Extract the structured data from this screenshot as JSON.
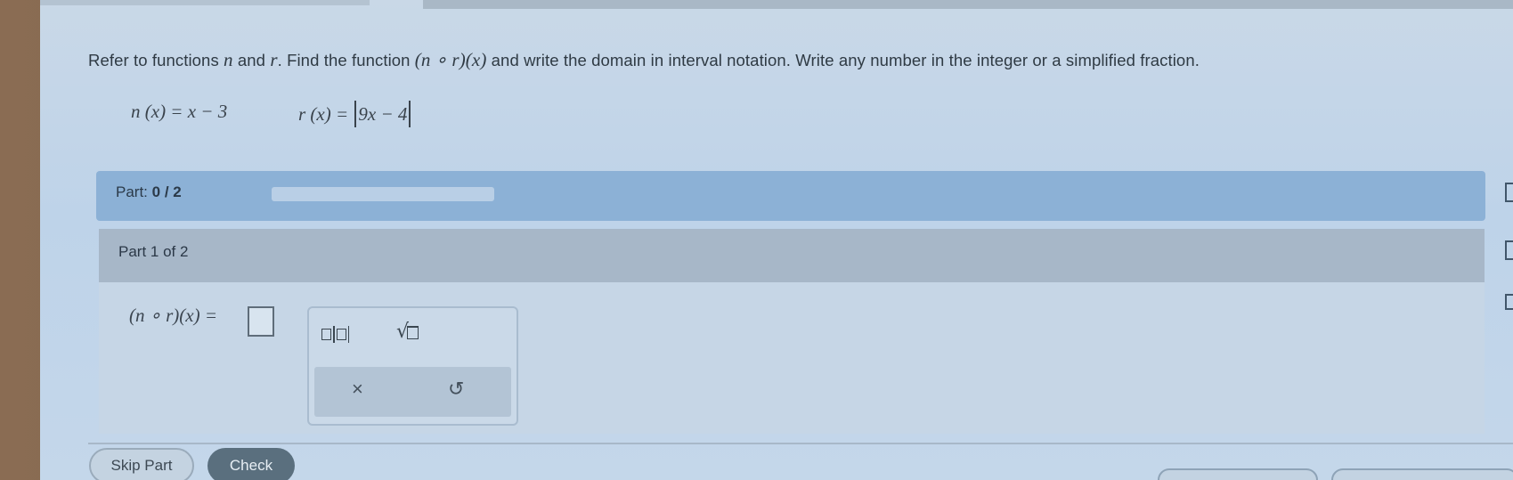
{
  "question": {
    "intro": "Refer to functions ",
    "var_n": "n",
    "and_text": " and ",
    "var_r": "r",
    "find_text": ". Find the function ",
    "composition": "(n ∘ r)(x)",
    "rest_text": " and write the domain in interval notation. Write any number in the integer or a simplified fraction."
  },
  "functions": {
    "n_lhs": "n (x) = x − 3",
    "r_lhs": "r (x) = ",
    "r_inner": "9x − 4"
  },
  "progress": {
    "label": "Part:",
    "value": "0 / 2",
    "fraction": 0
  },
  "part": {
    "header": "Part 1 of 2",
    "answer_label": "(n ∘ r)(x) ="
  },
  "palette": {
    "clear_symbol": "×",
    "undo_symbol": "↺",
    "sqrt_symbol": "√"
  },
  "buttons": {
    "skip": "Skip Part",
    "check": "Check"
  }
}
